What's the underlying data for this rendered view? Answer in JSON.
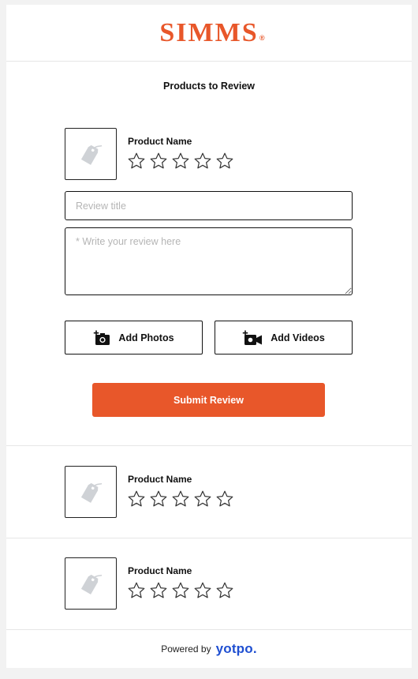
{
  "colors": {
    "brand": "#e8572a",
    "yotpo": "#1f4fd1",
    "star_outline": "#333333",
    "tag_icon": "#cfd2d6"
  },
  "header": {
    "logo_text": "SIMMS",
    "logo_registered": "®"
  },
  "section": {
    "title": "Products to Review"
  },
  "products": [
    {
      "name": "Product Name",
      "rating": 0,
      "image_icon": "tag-icon"
    },
    {
      "name": "Product Name",
      "rating": 0,
      "image_icon": "tag-icon"
    },
    {
      "name": "Product Name",
      "rating": 0,
      "image_icon": "tag-icon"
    }
  ],
  "form": {
    "title_placeholder": "Review title",
    "title_value": "",
    "body_placeholder": "* Write your review here",
    "body_value": "",
    "add_photos_label": "Add Photos",
    "add_photos_icon": "add-camera-icon",
    "add_videos_label": "Add Videos",
    "add_videos_icon": "add-video-icon",
    "submit_label": "Submit Review"
  },
  "footer": {
    "powered_by": "Powered by",
    "brand": "yotpo."
  }
}
